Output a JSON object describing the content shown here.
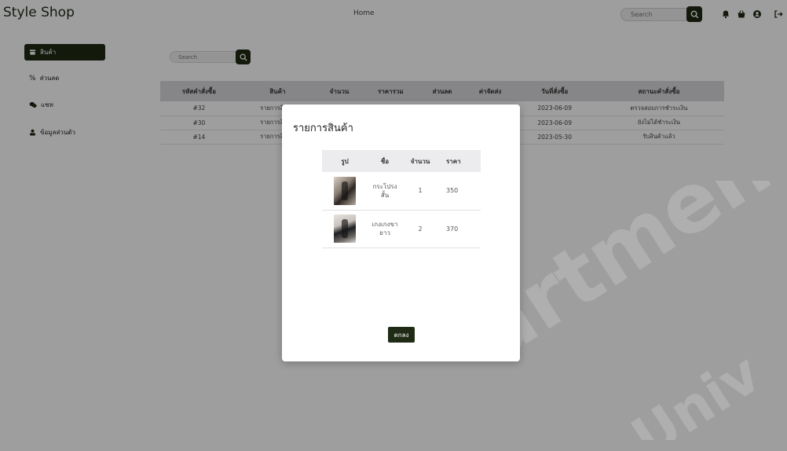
{
  "brand": "Style Shop",
  "nav": {
    "home": "Home"
  },
  "topbar": {
    "search_placeholder": "Search"
  },
  "sidebar": {
    "items": [
      {
        "label": "สินค้า",
        "icon": "store-icon",
        "active": true
      },
      {
        "label": "ส่วนลด",
        "icon": "percent-icon",
        "active": false
      },
      {
        "label": "แชท",
        "icon": "chat-icon",
        "active": false
      },
      {
        "label": "ข้อมูลส่วนตัว",
        "icon": "user-icon",
        "active": false
      }
    ]
  },
  "main": {
    "search_placeholder": "Search",
    "columns": [
      "รหัสคำสั่งซื้อ",
      "สินค้า",
      "จำนวน",
      "ราคารวม",
      "ส่วนลด",
      "ค่าจัดส่ง",
      "วันที่สั่งซื้อ",
      "สถานะคำสั่งซื้อ"
    ],
    "rows": [
      {
        "id": "#32",
        "product": "รายการสินค้า",
        "date": "2023-06-09",
        "status": "ตรวจสอบการชำระเงิน"
      },
      {
        "id": "#30",
        "product": "รายการสินค้า",
        "date": "2023-06-09",
        "status": "ยังไม่ได้ชำระเงิน"
      },
      {
        "id": "#14",
        "product": "รายการสินค้า",
        "date": "2023-05-30",
        "status": "รับสินค้าแล้ว"
      }
    ]
  },
  "modal": {
    "title": "รายการสินค้า",
    "columns": [
      "รูป",
      "ชื่อ",
      "จำนวน",
      "ราคา"
    ],
    "items": [
      {
        "name_line1": "กระโปรง",
        "name_line2": "สั้น",
        "qty": "1",
        "price": "350"
      },
      {
        "name_line1": "เกงเกงขา",
        "name_line2": "ยาว",
        "qty": "2",
        "price": "370"
      }
    ],
    "close_label": "ตกลง"
  },
  "colors": {
    "accent": "#1f2b14",
    "status_pending": "#e07a1e",
    "status_unpaid": "#c0392b",
    "status_done": "#3f8f1f"
  }
}
